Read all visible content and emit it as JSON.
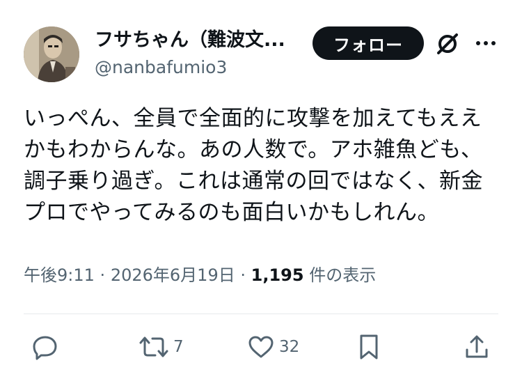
{
  "author": {
    "display_name": "フサちゃん（難波文...",
    "handle": "@nanbafumio3",
    "avatar_icon": "profile-photo"
  },
  "header": {
    "follow_label": "フォロー",
    "grok_icon": "grok-icon",
    "more_icon": "more-dots-icon"
  },
  "post": {
    "lines": [
      "いっぺん、全員で全面的に攻撃を加えてもええ",
      "かもわからんな。あの人数で。アホ雑魚ども、",
      "調子乗り過ぎ。これは通常の回ではなく、新金",
      "プロでやってみるのも面白いかもしれん。"
    ]
  },
  "meta": {
    "time": "午後9:11",
    "separator": "·",
    "date": "2026年6月19日",
    "views_count": "1,195",
    "views_label": "件の表示"
  },
  "actions": {
    "reply": {
      "icon": "reply-icon",
      "count": ""
    },
    "repost": {
      "icon": "repost-icon",
      "count": "7"
    },
    "like": {
      "icon": "heart-icon",
      "count": "32"
    },
    "bookmark": {
      "icon": "bookmark-icon",
      "count": ""
    },
    "share": {
      "icon": "share-icon",
      "count": ""
    }
  },
  "colors": {
    "text_primary": "#0f1419",
    "text_secondary": "#536471",
    "follow_button_bg": "#0f1419",
    "divider": "#e6e9eb"
  }
}
